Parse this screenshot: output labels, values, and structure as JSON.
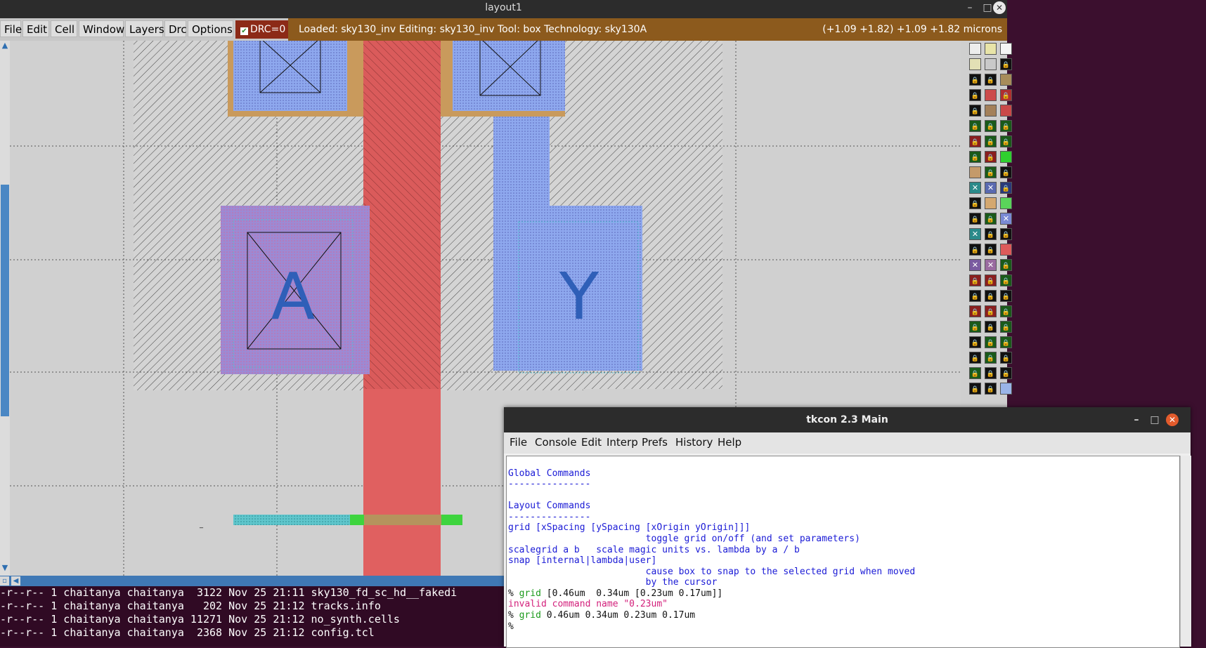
{
  "magic_window": {
    "title": "layout1",
    "menus": [
      "File",
      "Edit",
      "Cell",
      "Window",
      "Layers",
      "Drc",
      "Options"
    ],
    "drc_label": "DRC=0",
    "status_left": "Loaded: sky130_inv Editing: sky130_inv Tool: box  Technology: sky130A",
    "status_right": "(+1.09 +1.82) +1.09 +1.82 microns",
    "labels": {
      "input": "A",
      "output": "Y"
    }
  },
  "terminal": {
    "lines": [
      "-r--r-- 1 chaitanya chaitanya  3122 Nov 25 21:11 sky130_fd_sc_hd__fakedi",
      "-r--r-- 1 chaitanya chaitanya   202 Nov 25 21:12 tracks.info",
      "-r--r-- 1 chaitanya chaitanya 11271 Nov 25 21:12 no_synth.cells",
      "-r--r-- 1 chaitanya chaitanya  2368 Nov 25 21:12 config.tcl"
    ]
  },
  "tkcon": {
    "title": "tkcon 2.3 Main",
    "menus": [
      "File",
      "Console",
      "Edit",
      "Interp",
      "Prefs",
      "History",
      "Help"
    ],
    "lines": [
      {
        "text": "Global Commands",
        "color": "blue"
      },
      {
        "text": "---------------",
        "color": "blue"
      },
      {
        "text": "",
        "color": "blue"
      },
      {
        "text": "Layout Commands",
        "color": "blue"
      },
      {
        "text": "---------------",
        "color": "blue"
      },
      {
        "text": "grid [xSpacing [ySpacing [xOrigin yOrigin]]]",
        "color": "blue"
      },
      {
        "text": "                         toggle grid on/off (and set parameters)",
        "color": "blue"
      },
      {
        "text": "scalegrid a b   scale magic units vs. lambda by a / b",
        "color": "blue"
      },
      {
        "text": "snap [internal|lambda|user]",
        "color": "blue"
      },
      {
        "text": "                         cause box to snap to the selected grid when moved",
        "color": "blue"
      },
      {
        "text": "                         by the cursor",
        "color": "blue"
      },
      {
        "text": "grid [0.46um  0.34um [0.23um 0.17um]]",
        "color": "prompt"
      },
      {
        "text": "invalid command name \"0.23um\"",
        "color": "red"
      },
      {
        "text": "grid 0.46um 0.34um 0.23um 0.17um",
        "color": "prompt"
      },
      {
        "text": "",
        "color": "prompt"
      }
    ]
  },
  "colors": {
    "poly": "#e06060",
    "locali": "#8fa6e6",
    "mcon": "#a58fd0",
    "status_bar": "#8c5a1d",
    "drc_bg": "#8c2a17"
  }
}
